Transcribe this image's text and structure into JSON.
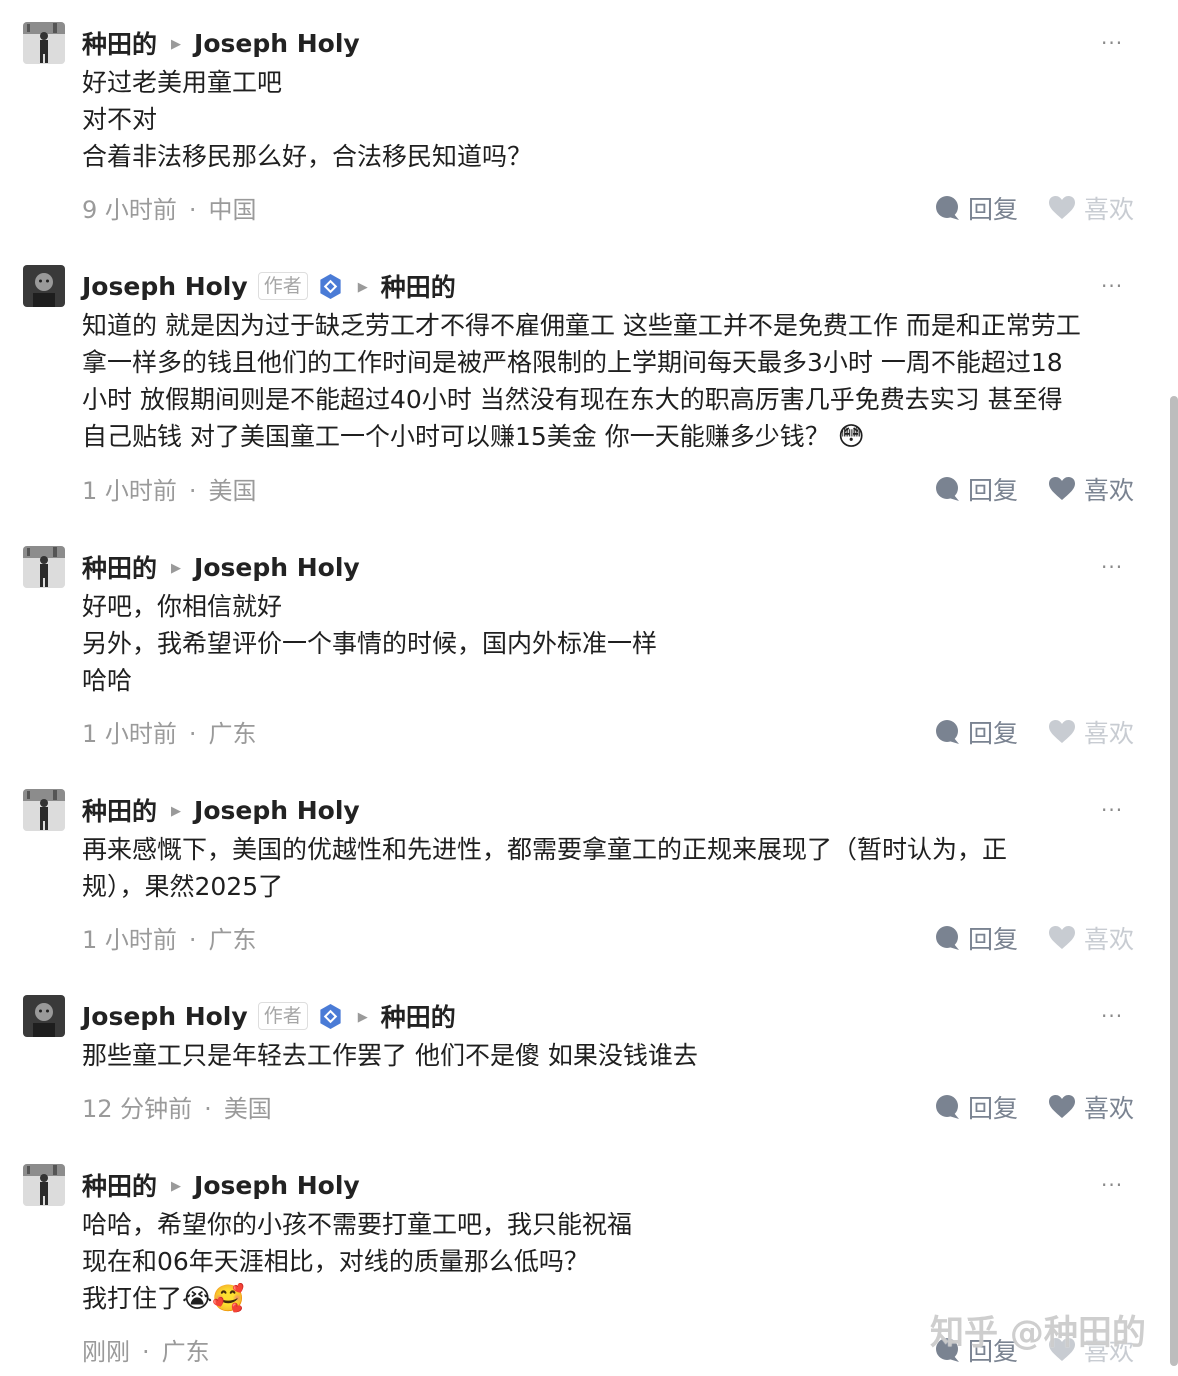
{
  "comments": [
    {
      "author": "种田的",
      "reply_to": "Joseph Holy",
      "lines": [
        "好过老美用童工吧",
        "对不对",
        "合着非法移民那么好，合法移民知道吗？"
      ],
      "time": "9 小时前",
      "location": "中国",
      "reply_label": "回复",
      "like_label": "喜欢",
      "liked": false
    },
    {
      "author": "Joseph Holy",
      "author_badge": "作者",
      "reply_to": "种田的",
      "lines": [
        "知道的 就是因为过于缺乏劳工才不得不雇佣童工 这些童工并不是免费工作 而是和正常劳工",
        "拿一样多的钱且他们的工作时间是被严格限制的上学期间每天最多3小时 一周不能超过18",
        "小时 放假期间则是不能超过40小时 当然没有现在东大的职高厉害几乎免费去实习 甚至得",
        "自己贴钱 对了美国童工一个小时可以赚15美金 你一天能赚多少钱？"
      ],
      "emoji": "😳",
      "time": "1 小时前",
      "location": "美国",
      "reply_label": "回复",
      "like_label": "喜欢",
      "liked": true
    },
    {
      "author": "种田的",
      "reply_to": "Joseph Holy",
      "lines": [
        "好吧，你相信就好",
        "另外，我希望评价一个事情的时候，国内外标准一样",
        "哈哈"
      ],
      "time": "1 小时前",
      "location": "广东",
      "reply_label": "回复",
      "like_label": "喜欢",
      "liked": false
    },
    {
      "author": "种田的",
      "reply_to": "Joseph Holy",
      "lines": [
        "再来感慨下，美国的优越性和先进性，都需要拿童工的正规来展现了（暂时认为，正",
        "规），果然2025了"
      ],
      "time": "1 小时前",
      "location": "广东",
      "reply_label": "回复",
      "like_label": "喜欢",
      "liked": false
    },
    {
      "author": "Joseph Holy",
      "author_badge": "作者",
      "reply_to": "种田的",
      "lines": [
        "那些童工只是年轻去工作罢了 他们不是傻 如果没钱谁去"
      ],
      "time": "12 分钟前",
      "location": "美国",
      "reply_label": "回复",
      "like_label": "喜欢",
      "liked": true
    },
    {
      "author": "种田的",
      "reply_to": "Joseph Holy",
      "lines": [
        "哈哈，希望你的小孩不需要打童工吧，我只能祝福",
        "现在和06年天涯相比，对线的质量那么低吗？",
        "我打住了"
      ],
      "emoji": "😭🥰",
      "time": "刚刚",
      "location": "广东",
      "reply_label": "回复",
      "like_label": "喜欢",
      "liked": false
    }
  ],
  "more_label": "···",
  "watermark": "知乎 @种田的",
  "colors": {
    "like_on": "#7a8391",
    "like_off": "#c8ccd2",
    "verified": "#4a7bd6"
  }
}
